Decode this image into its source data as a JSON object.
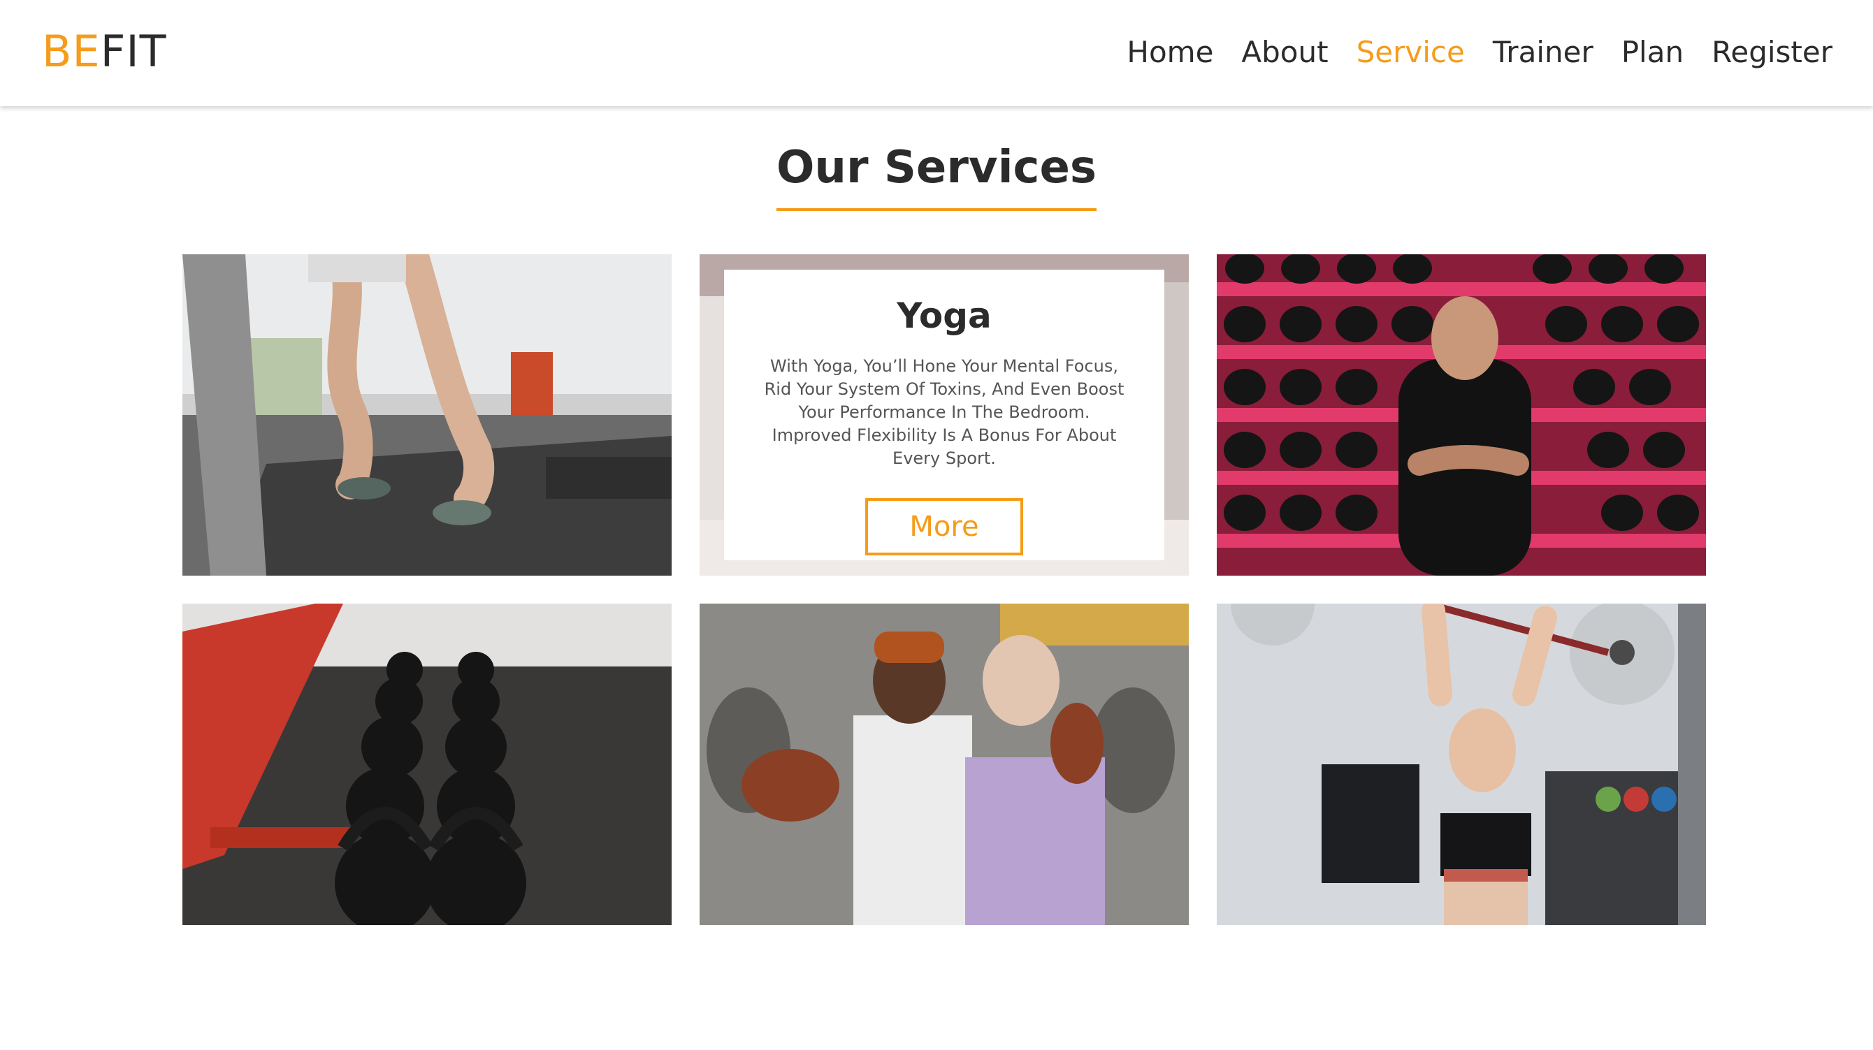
{
  "brand": {
    "accent": "BE",
    "rest": "FIT",
    "accent_color": "#f59c1a"
  },
  "nav": [
    {
      "label": "Home",
      "active": false
    },
    {
      "label": "About",
      "active": false
    },
    {
      "label": "Service",
      "active": true
    },
    {
      "label": "Trainer",
      "active": false
    },
    {
      "label": "Plan",
      "active": false
    },
    {
      "label": "Register",
      "active": false
    }
  ],
  "section": {
    "title": "Our Services"
  },
  "cards": [
    {
      "image": "treadmill-photo"
    },
    {
      "image": "yoga-studio-photo",
      "heading": "Yoga",
      "description": "With Yoga, You’ll Hone Your Mental Focus, Rid Your System Of Toxins, And Even Boost Your Performance In The Bedroom. Improved Flexibility Is A Bonus For About Every Sport.",
      "button": "More"
    },
    {
      "image": "boxing-gloves-trainer-photo"
    },
    {
      "image": "kettlebells-photo"
    },
    {
      "image": "boxing-coaching-photo"
    },
    {
      "image": "barbell-overhead-photo"
    }
  ]
}
